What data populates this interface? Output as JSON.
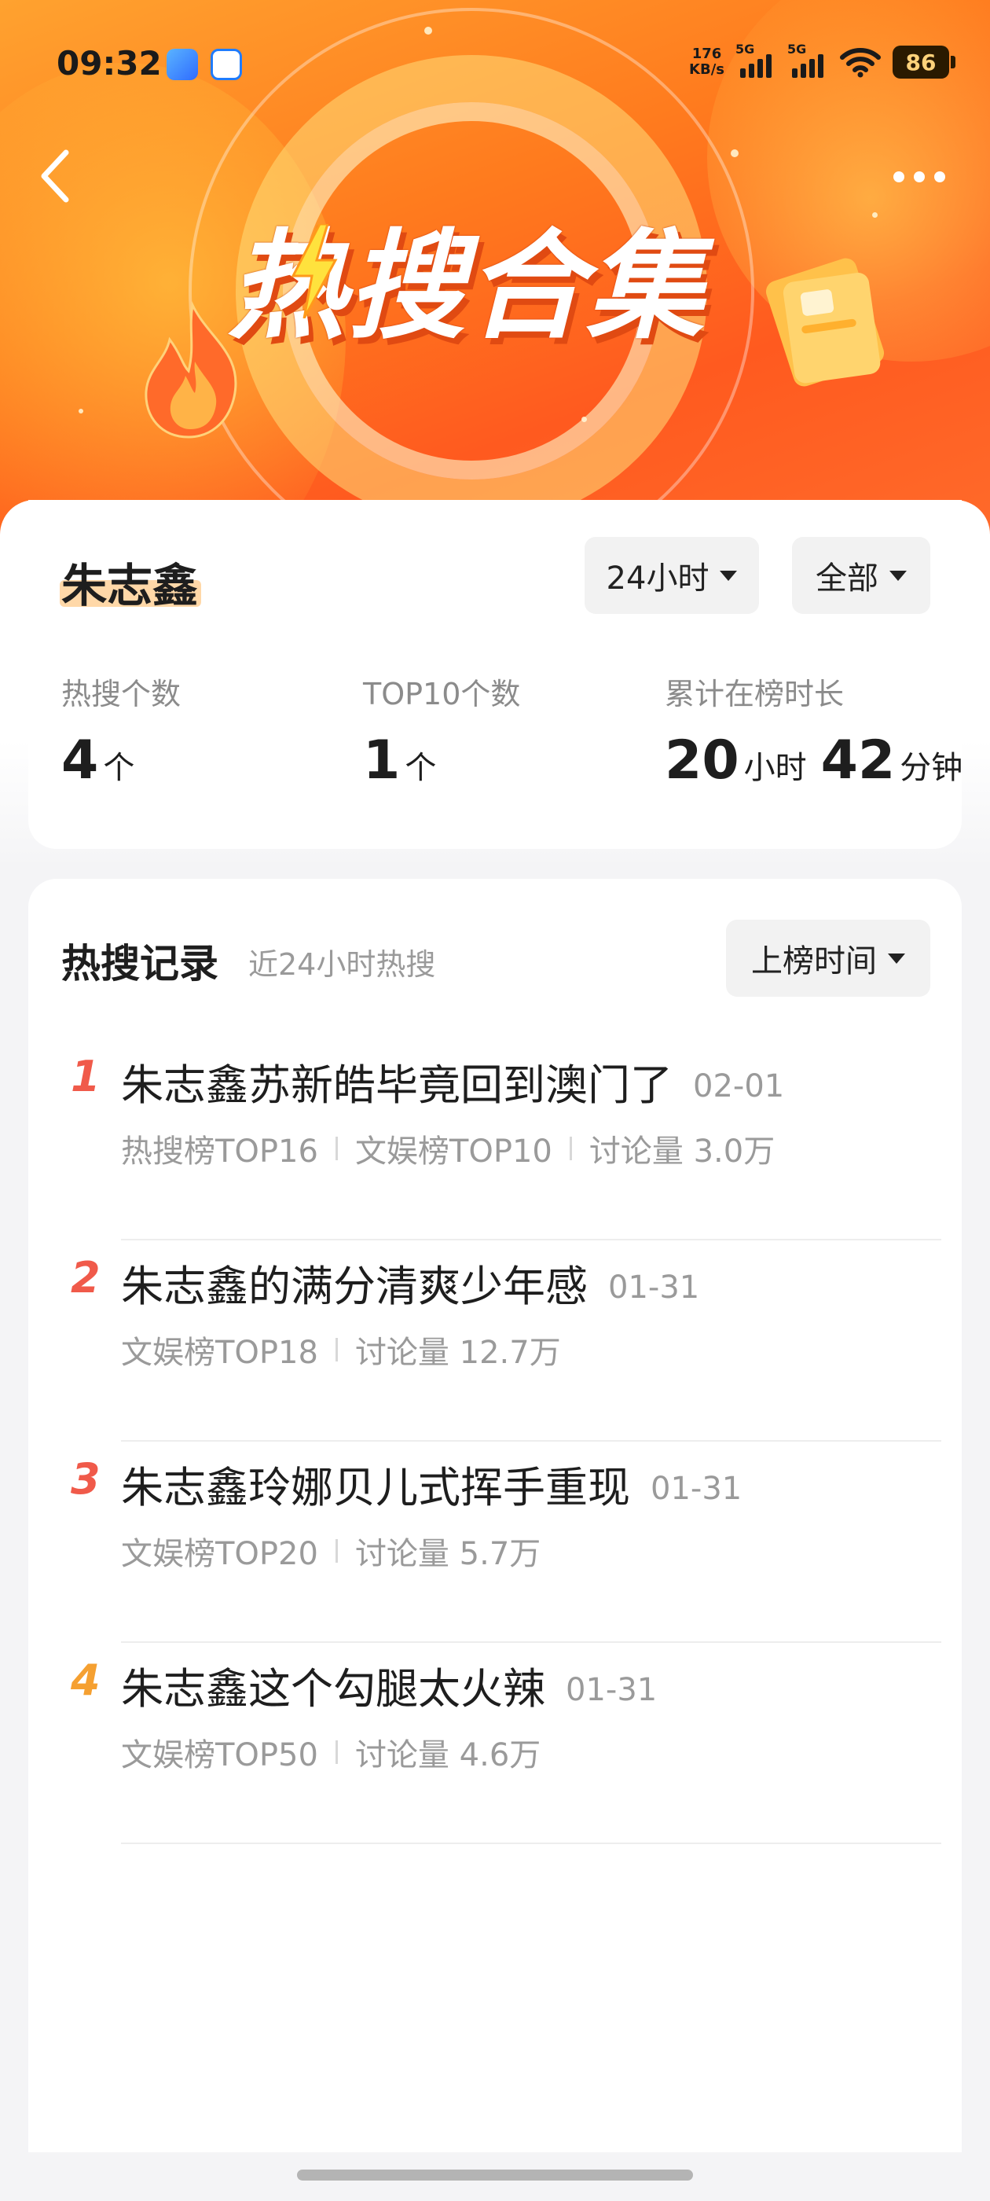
{
  "status_bar": {
    "time": "09:32",
    "net_speed_value": "176",
    "net_speed_unit": "KB/s",
    "signal1_label": "5G",
    "signal2_label": "5G",
    "battery": "86",
    "app_icons": [
      "app-icon-blue",
      "app-icon-chat"
    ]
  },
  "header": {
    "banner_title": "热搜合集",
    "back_icon": "chevron-left-icon",
    "more_icon": "more-horizontal-icon"
  },
  "summary": {
    "name": "朱志鑫",
    "time_filter": "24小时",
    "category_filter": "全部",
    "stats": [
      {
        "label": "热搜个数",
        "value": "4",
        "unit": "个"
      },
      {
        "label": "TOP10个数",
        "value": "1",
        "unit": "个"
      },
      {
        "label": "累计在榜时长",
        "hours": "20",
        "hours_unit": "小时",
        "minutes": "42",
        "minutes_unit": "分钟"
      }
    ]
  },
  "records": {
    "title": "热搜记录",
    "subtitle": "近24小时热搜",
    "sort_label": "上榜时间",
    "items": [
      {
        "rank": "1",
        "title": "朱志鑫苏新皓毕竟回到澳门了",
        "date": "02-01",
        "meta": [
          "热搜榜TOP16",
          "文娱榜TOP10",
          "讨论量 3.0万"
        ]
      },
      {
        "rank": "2",
        "title": "朱志鑫的满分清爽少年感",
        "date": "01-31",
        "meta": [
          "文娱榜TOP18",
          "讨论量 12.7万"
        ]
      },
      {
        "rank": "3",
        "title": "朱志鑫玲娜贝儿式挥手重现",
        "date": "01-31",
        "meta": [
          "文娱榜TOP20",
          "讨论量 5.7万"
        ]
      },
      {
        "rank": "4",
        "title": "朱志鑫这个勾腿太火辣",
        "date": "01-31",
        "meta": [
          "文娱榜TOP50",
          "讨论量 4.6万"
        ]
      }
    ]
  },
  "colors": {
    "rank_top3": "#f05a4a",
    "rank_other": "#f5a031",
    "banner_orange": "#ff7b1e",
    "name_highlight": "#ffd8a8"
  }
}
